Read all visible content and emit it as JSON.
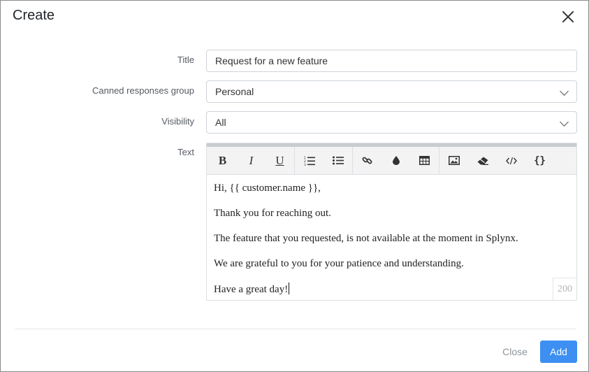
{
  "modal": {
    "title": "Create",
    "close_icon": "close-icon"
  },
  "form": {
    "title_label": "Title",
    "title_value": "Request for a new feature",
    "group_label": "Canned responses group",
    "group_value": "Personal",
    "visibility_label": "Visibility",
    "visibility_value": "All",
    "text_label": "Text"
  },
  "editor": {
    "toolbar": {
      "bold_label": "B",
      "italic_label": "I",
      "underline_label": "U",
      "ordered_list_icon": "ordered-list-icon",
      "unordered_list_icon": "unordered-list-icon",
      "link_icon": "link-icon",
      "color_icon": "drop-icon",
      "table_icon": "table-icon",
      "image_icon": "image-icon",
      "eraser_icon": "eraser-icon",
      "code_view_icon": "code-icon",
      "variables_label": "{}"
    },
    "lines": [
      "Hi, {{ customer.name }},",
      "Thank you for reaching out.",
      "The feature that you requested, is not available at the moment in Splynx.",
      "We are grateful to you for your patience and understanding.",
      "Have a great day!"
    ],
    "char_counter": "200"
  },
  "footer": {
    "close_label": "Close",
    "add_label": "Add"
  },
  "colors": {
    "accent": "#3d8ff2",
    "border": "#ced4da"
  }
}
